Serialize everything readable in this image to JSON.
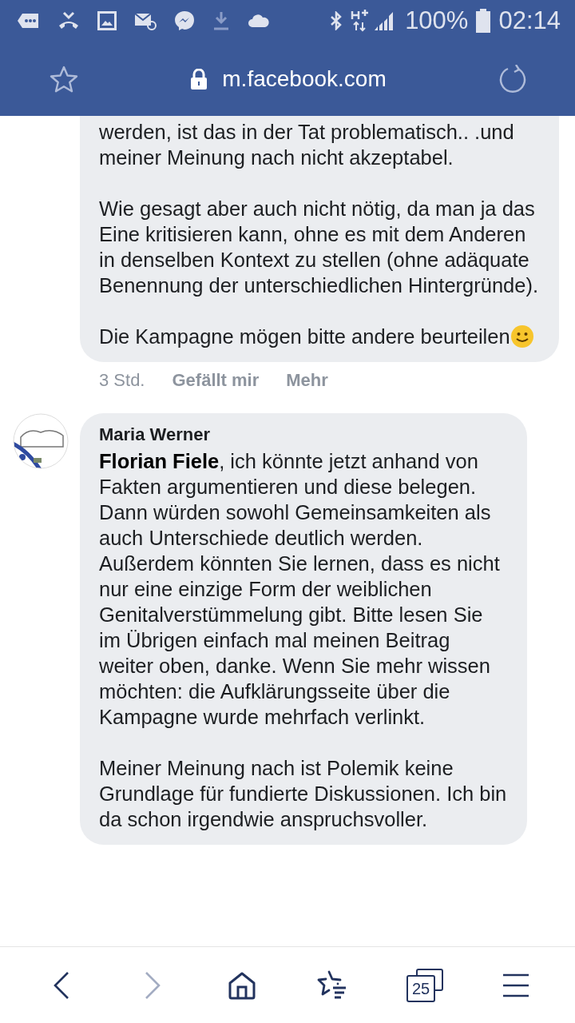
{
  "status_bar": {
    "battery": "100%",
    "time": "02:14"
  },
  "browser_bar": {
    "url": "m.facebook.com"
  },
  "comments": [
    {
      "paragraphs": [
        {
          "kind": "plain",
          "text": "werden, ist das in der Tat problematisch.. .und meiner Meinung nach nicht akzeptabel."
        },
        {
          "kind": "plain",
          "text": "Wie gesagt aber auch nicht nötig, da man ja das Eine kritisieren kann, ohne es mit dem Anderen in denselben Kontext zu stellen (ohne adäquate Benennung der unterschiedlichen Hintergründe)."
        },
        {
          "kind": "smiley_end",
          "text": "Die Kampagne mögen bitte andere beurteilen"
        }
      ],
      "time": "3 Std.",
      "actions": [
        "Gefällt mir",
        "Mehr"
      ]
    },
    {
      "avatar": true,
      "author": "Maria Werner",
      "paragraphs": [
        {
          "kind": "plain",
          "text": "**Florian Fiele**, ich könnte jetzt anhand von Fakten argumentieren und diese belegen. Dann würden sowohl Gemeinsamkeiten als auch Unterschiede deutlich werden. Außerdem könnten Sie lernen, dass es nicht nur eine einzige Form der weiblichen Genitalverstümmelung gibt. Bitte lesen Sie im Übrigen einfach mal meinen Beitrag weiter oben, danke. Wenn Sie mehr wissen möchten: die Aufklärungsseite über die Kampagne wurde mehrfach verlinkt."
        },
        {
          "kind": "plain",
          "text": "Meiner Meinung nach ist Polemik keine Grundlage für fundierte Diskussionen. Ich bin da schon irgendwie anspruchsvoller."
        }
      ]
    }
  ],
  "bottom_nav": {
    "back_enabled": true,
    "forward_enabled": false,
    "tab_count": "25"
  }
}
